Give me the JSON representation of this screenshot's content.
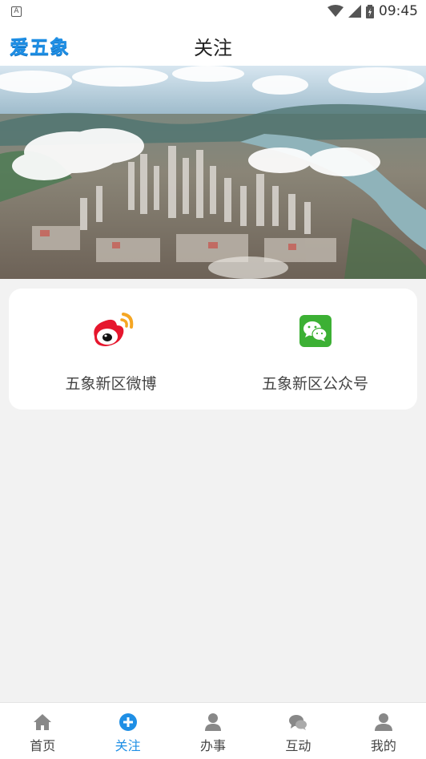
{
  "status_bar": {
    "time": "09:45",
    "notification_badge": "A"
  },
  "app_bar": {
    "logo_text": "爱五象",
    "title": "关注"
  },
  "follow_card": {
    "items": [
      {
        "label": "五象新区微博",
        "icon": "weibo-icon"
      },
      {
        "label": "五象新区公众号",
        "icon": "wechat-icon"
      }
    ]
  },
  "tab_bar": {
    "tabs": [
      {
        "label": "首页",
        "icon": "home-icon",
        "active": false
      },
      {
        "label": "关注",
        "icon": "plus-circle-icon",
        "active": true
      },
      {
        "label": "办事",
        "icon": "person-icon",
        "active": false
      },
      {
        "label": "互动",
        "icon": "chat-icon",
        "active": false
      },
      {
        "label": "我的",
        "icon": "user-icon",
        "active": false
      }
    ]
  },
  "colors": {
    "accent": "#1f8fe5",
    "background": "#f2f2f2",
    "wechat_green": "#3cb034",
    "weibo_red": "#e6162d"
  }
}
